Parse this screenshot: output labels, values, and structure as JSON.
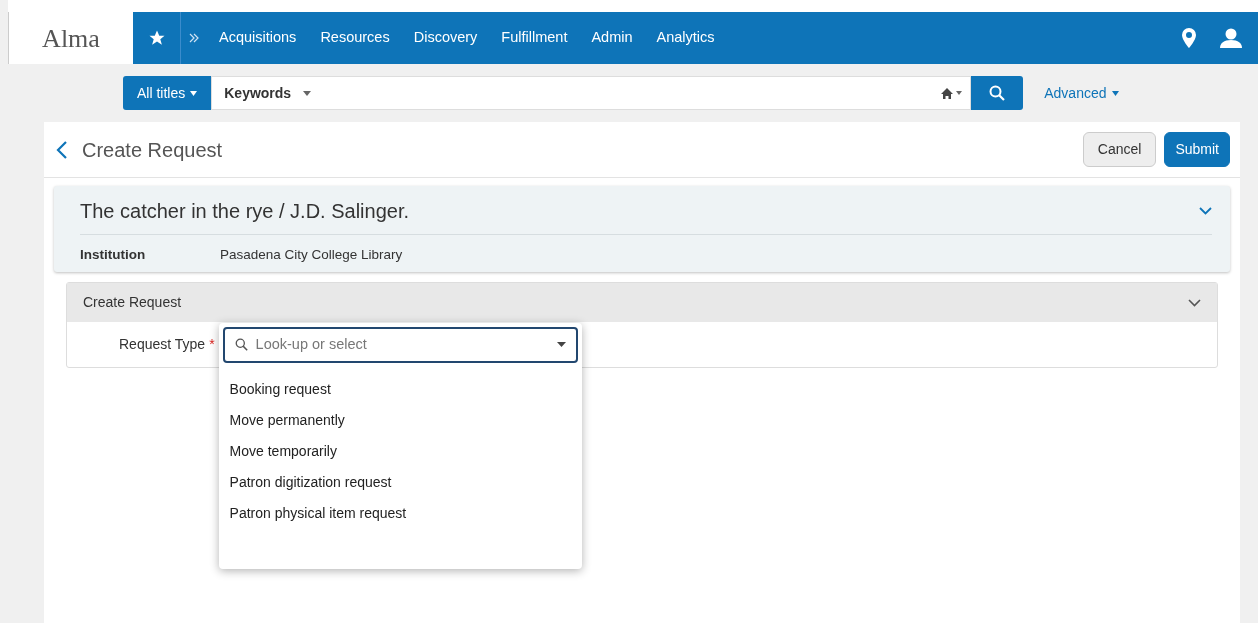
{
  "app": {
    "logo": "Alma"
  },
  "nav": {
    "items": [
      "Acquisitions",
      "Resources",
      "Discovery",
      "Fulfillment",
      "Admin",
      "Analytics"
    ]
  },
  "search": {
    "scope": "All titles",
    "field": "Keywords",
    "advanced": "Advanced"
  },
  "page": {
    "title": "Create Request",
    "buttons": [
      {
        "label": "Cancel",
        "kind": "secondary"
      },
      {
        "label": "Submit",
        "kind": "primary"
      }
    ]
  },
  "record": {
    "title": "The catcher in the rye / J.D. Salinger.",
    "fields": [
      {
        "label": "Institution",
        "value": "Pasadena City College Library"
      }
    ]
  },
  "section": {
    "title": "Create Request",
    "expanded": true,
    "form": {
      "label": "Request Type",
      "required_mark": "*",
      "placeholder": "Look-up or select",
      "options": [
        {
          "label": "Booking request"
        },
        {
          "label": "Move permanently"
        },
        {
          "label": "Move temporarily"
        },
        {
          "label": "Patron digitization request"
        },
        {
          "label": "Patron physical item request"
        }
      ]
    }
  }
}
